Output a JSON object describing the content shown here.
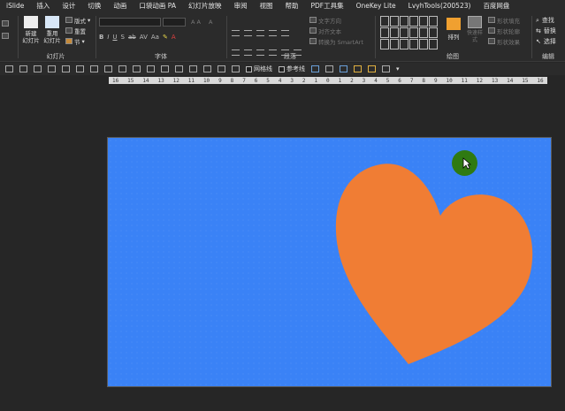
{
  "menu": {
    "tabs": [
      "iSlide",
      "插入",
      "设计",
      "切换",
      "动画",
      "口袋动画 PA",
      "幻灯片放映",
      "审阅",
      "视图",
      "帮助",
      "PDF工具集",
      "OneKey Lite",
      "LvyhTools(200523)",
      "百度网盘"
    ]
  },
  "ribbon": {
    "slides_group": {
      "label": "幻灯片",
      "new_slide": "新建\n幻灯片",
      "reuse_slide": "重用\n幻灯片",
      "layout": "版式",
      "reset": "重置",
      "section": "节"
    },
    "font_group": {
      "label": "字体"
    },
    "paragraph_group": {
      "label": "段落",
      "text_direction": "文字方向",
      "align_text": "对齐文本",
      "smartart": "转换为 SmartArt"
    },
    "drawing_group": {
      "label": "绘图",
      "arrange": "排列",
      "quick_styles": "快速样式",
      "shape_fill": "形状填充",
      "shape_outline": "形状轮廓",
      "shape_effects": "形状效果"
    },
    "editing_group": {
      "label": "编辑",
      "find": "查找",
      "replace": "替换",
      "select": "选择"
    }
  },
  "qat": {
    "gridlines": "网格线",
    "guides": "参考线"
  },
  "ruler": {
    "ticks": [
      "16",
      "15",
      "14",
      "13",
      "12",
      "11",
      "10",
      "9",
      "8",
      "7",
      "6",
      "5",
      "4",
      "3",
      "2",
      "1",
      "0",
      "1",
      "2",
      "3",
      "4",
      "5",
      "6",
      "7",
      "8",
      "9",
      "10",
      "11",
      "12",
      "13",
      "14",
      "15",
      "16"
    ]
  },
  "colors": {
    "slide_background": "#3a82f6",
    "heart": "#f07d34",
    "cursor_ring": "#2f7a12",
    "app_background": "#262626"
  }
}
